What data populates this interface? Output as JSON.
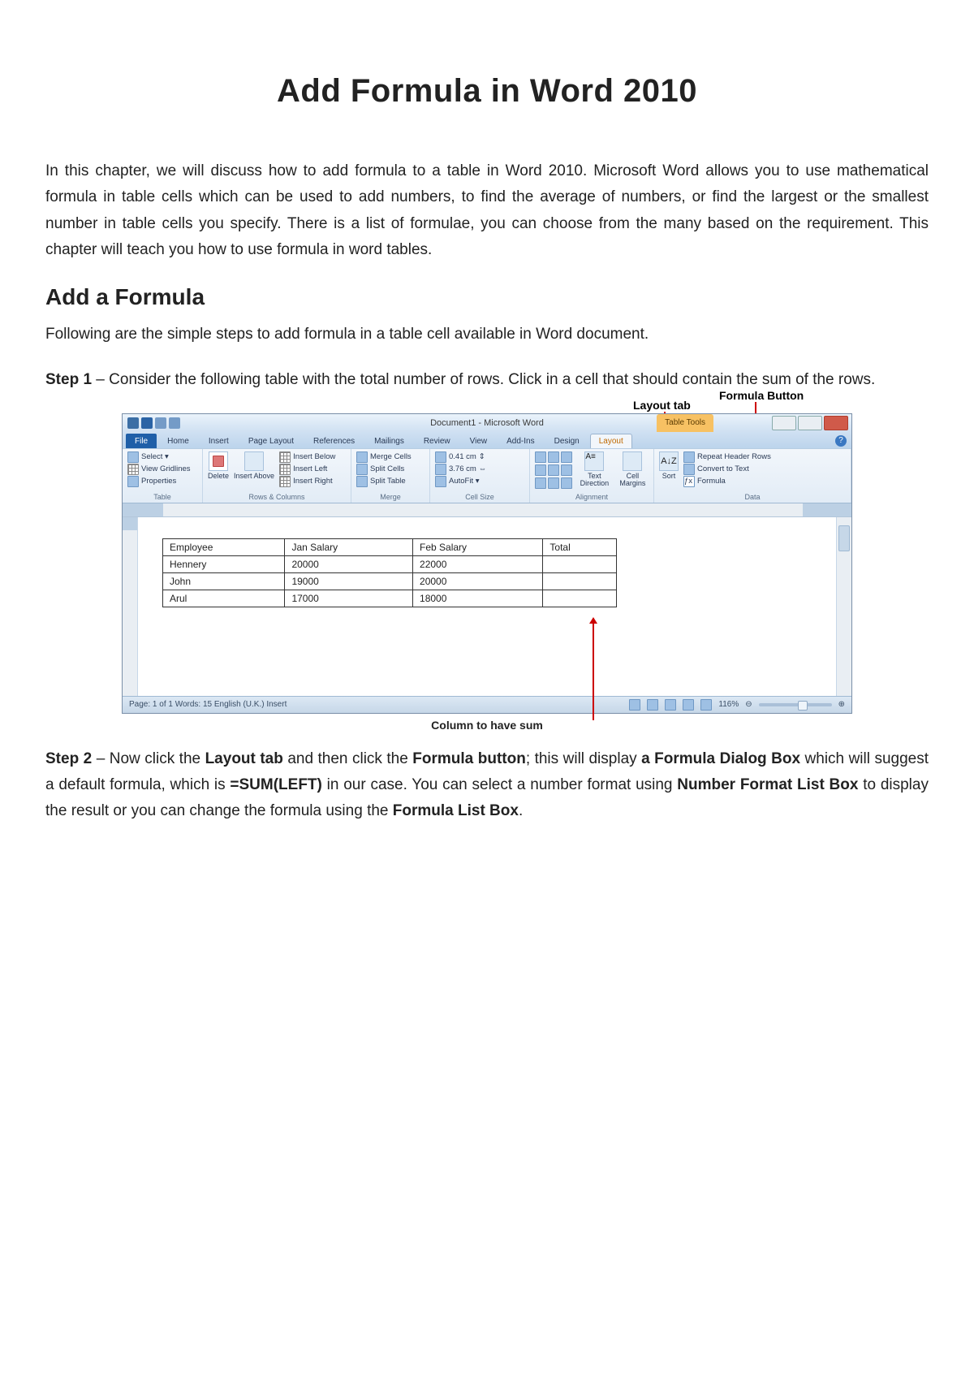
{
  "title": "Add Formula in Word 2010",
  "intro": "In this chapter, we will discuss how to add formula to a table in Word 2010. Microsoft Word allows you to use mathematical formula in table cells which can be used to add numbers, to find the average of numbers, or find the largest or the smallest number in table cells you specify. There is a list of formulae, you can choose from the many based on the requirement. This chapter will teach you how to use formula in word tables.",
  "section_heading": "Add a Formula",
  "section_intro": "Following are the simple steps to add formula in a table cell available in Word document.",
  "step1_label": "Step 1",
  "step1_text": " – Consider the following table with the total number of rows. Click in a cell that should contain the sum of the rows.",
  "callouts": {
    "layout": "Layout tab",
    "formula": "Formula Button",
    "column": "Column to have sum"
  },
  "word": {
    "doc_title": "Document1 - Microsoft Word",
    "table_tools": "Table Tools",
    "tabs": [
      "File",
      "Home",
      "Insert",
      "Page Layout",
      "References",
      "Mailings",
      "Review",
      "View",
      "Add-Ins",
      "Design",
      "Layout"
    ],
    "ribbon_groups": {
      "table": {
        "label": "Table",
        "items": [
          "Select ▾",
          "View Gridlines",
          "Properties"
        ]
      },
      "rows_cols": {
        "label": "Rows & Columns",
        "delete": "Delete",
        "insert_above": "Insert Above",
        "items": [
          "Insert Below",
          "Insert Left",
          "Insert Right"
        ]
      },
      "merge": {
        "label": "Merge",
        "items": [
          "Merge Cells",
          "Split Cells",
          "Split Table"
        ]
      },
      "cell_size": {
        "label": "Cell Size",
        "h": "0.41 cm",
        "w": "3.76 cm",
        "autofit": "AutoFit ▾"
      },
      "alignment": {
        "label": "Alignment",
        "text_dir": "Text Direction",
        "margins": "Cell Margins"
      },
      "data": {
        "label": "Data",
        "sort": "Sort",
        "items": [
          "Repeat Header Rows",
          "Convert to Text",
          "Formula"
        ],
        "az": "A↓Z"
      }
    },
    "table_data": {
      "headers": [
        "Employee",
        "Jan Salary",
        "Feb Salary",
        "Total"
      ],
      "rows": [
        [
          "Hennery",
          "20000",
          "22000",
          ""
        ],
        [
          "John",
          "19000",
          "20000",
          ""
        ],
        [
          "Arul",
          "17000",
          "18000",
          ""
        ]
      ]
    },
    "status": {
      "left": "Page: 1 of 1   Words: 15      English (U.K.)   Insert",
      "zoom": "116%"
    }
  },
  "step2_label": "Step 2",
  "step2_pre": " – Now click the ",
  "step2_b1": "Layout tab",
  "step2_mid1": " and then click the ",
  "step2_b2": "Formula button",
  "step2_mid2": "; this will display ",
  "step2_b3": "a Formula Dialog Box",
  "step2_mid3": " which will suggest a default formula, which is ",
  "step2_b4": "=SUM(LEFT)",
  "step2_mid4": " in our case. You can select a number format using ",
  "step2_b5": "Number Format List Box",
  "step2_mid5": " to display the result or you can change the formula using the ",
  "step2_b6": "Formula List Box",
  "step2_end": "."
}
